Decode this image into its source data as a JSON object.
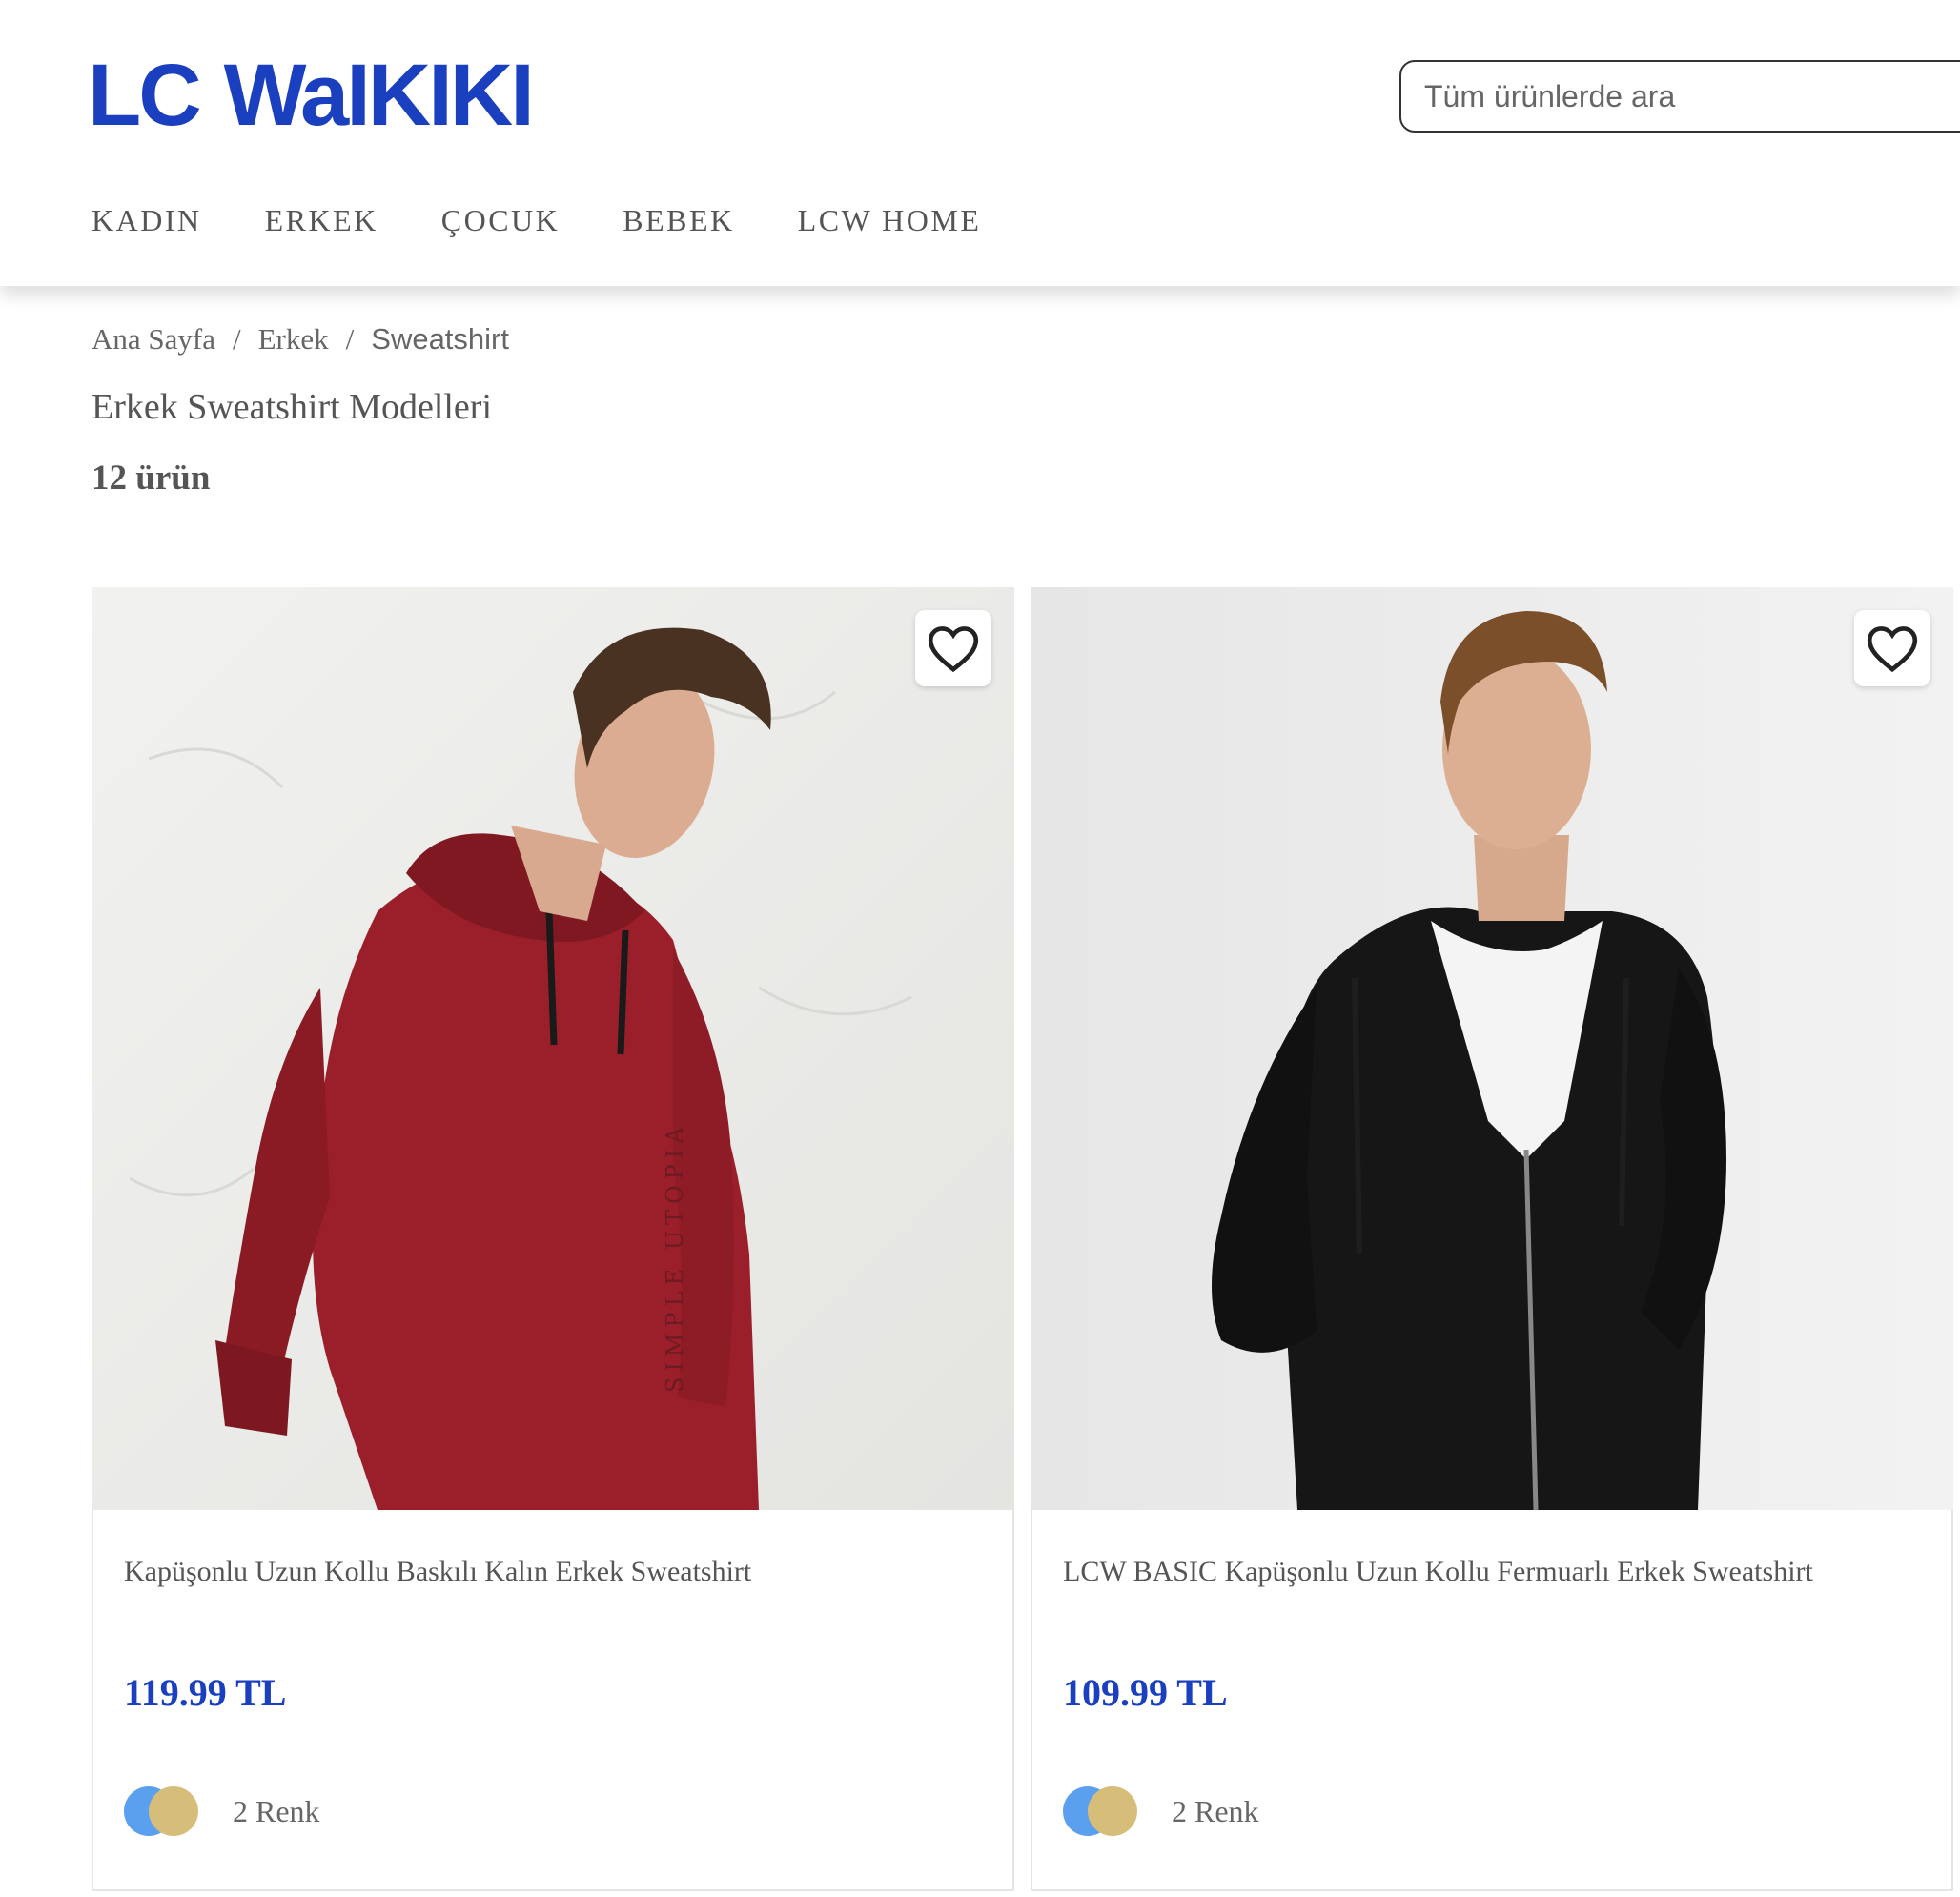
{
  "header": {
    "logo_lc": "LC",
    "logo_waikiki": "WaIKIKI",
    "search_placeholder": "Tüm ürünlerde ara"
  },
  "nav": [
    "KADIN",
    "ERKEK",
    "ÇOCUK",
    "BEBEK",
    "LCW HOME"
  ],
  "breadcrumb": [
    "Ana Sayfa",
    "Erkek",
    "Sweatshirt"
  ],
  "breadcrumb_separator": "/",
  "page": {
    "title": "Erkek Sweatshirt Modelleri",
    "count": "12 ürün"
  },
  "products": [
    {
      "name": "Kapüşonlu Uzun Kollu Baskılı Kalın Erkek Sweatshirt",
      "price": "119.99 TL",
      "colors": "2 Renk",
      "print_text": "SIMPLE UTOPIA"
    },
    {
      "name": "LCW BASIC Kapüşonlu Uzun Kollu Fermuarlı Erkek Sweatshirt",
      "price": "109.99 TL",
      "colors": "2 Renk"
    }
  ],
  "colors": {
    "brand_blue": "#1a3fbf",
    "swatch_blue": "#5aa0ef",
    "swatch_gold": "#d6be7a",
    "hoodie_red": "#9b1f2a",
    "hoodie_black": "#161616"
  },
  "icons": {
    "favorite": "heart-outline-icon"
  }
}
